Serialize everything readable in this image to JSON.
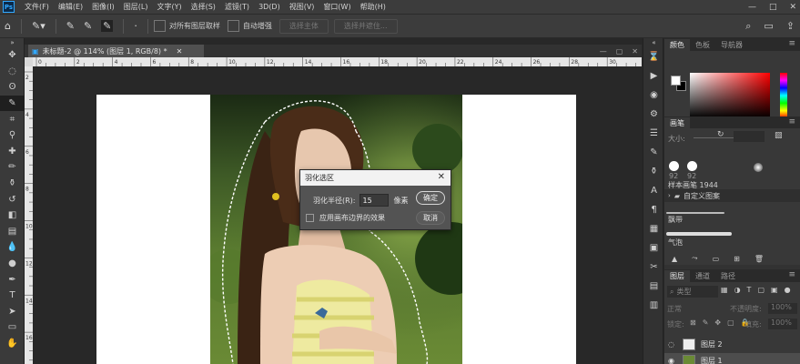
{
  "app": {
    "logo": "Ps"
  },
  "menu": [
    "文件(F)",
    "编辑(E)",
    "图像(I)",
    "图层(L)",
    "文字(Y)",
    "选择(S)",
    "滤镜(T)",
    "3D(D)",
    "视图(V)",
    "窗口(W)",
    "帮助(H)"
  ],
  "window_controls": {
    "minimize": "—",
    "maximize": "□",
    "close": "✕"
  },
  "options": {
    "sample_all_layers_label": "对所有图层取样",
    "auto_enhance_label": "自动增强",
    "select_subject_label": "选择主体",
    "select_mask_label": "选择并遮住..."
  },
  "document": {
    "tab_title": "未标题-2 @ 114% (图层 1, RGB/8) *",
    "close_glyph": "✕",
    "ruler_top_ticks": [
      "0",
      "2",
      "4",
      "6",
      "8",
      "10",
      "12",
      "14",
      "16",
      "18",
      "20",
      "22",
      "24",
      "26",
      "28",
      "30"
    ],
    "ruler_left_ticks": [
      "2",
      "4",
      "6",
      "8",
      "10",
      "12",
      "14",
      "16"
    ]
  },
  "dialog": {
    "title": "羽化选区",
    "radius_label": "羽化半径(R):",
    "radius_value": "15",
    "unit": "像素",
    "edge_checkbox_label": "应用画布边界的效果",
    "ok_label": "确定",
    "cancel_label": "取消",
    "close_glyph": "✕"
  },
  "panels": {
    "color_tabs": [
      "颜色",
      "色板",
      "导航器"
    ],
    "brush_tab": "画笔",
    "size_label": "大小:",
    "brush_size_1": "92",
    "brush_size_2": "92",
    "preset_name": "样本画笔 1944",
    "custom_group": "自定义图案",
    "stroke_1": "飘带",
    "stroke_2": "气泡",
    "layers_tabs": [
      "图层",
      "通道",
      "路径"
    ],
    "layers_search": "类型",
    "blend_mode": "正常",
    "opacity_label": "不透明度:",
    "opacity_value": "100%",
    "lock_label": "锁定:",
    "fill_label": "填充:",
    "fill_value": "100%",
    "layers": [
      "图层 2",
      "图层 1"
    ]
  },
  "colors": {
    "accent": "#31a8ff",
    "foreground": "#ffffff",
    "background": "#000000",
    "selection_ants": "#ffffff"
  }
}
